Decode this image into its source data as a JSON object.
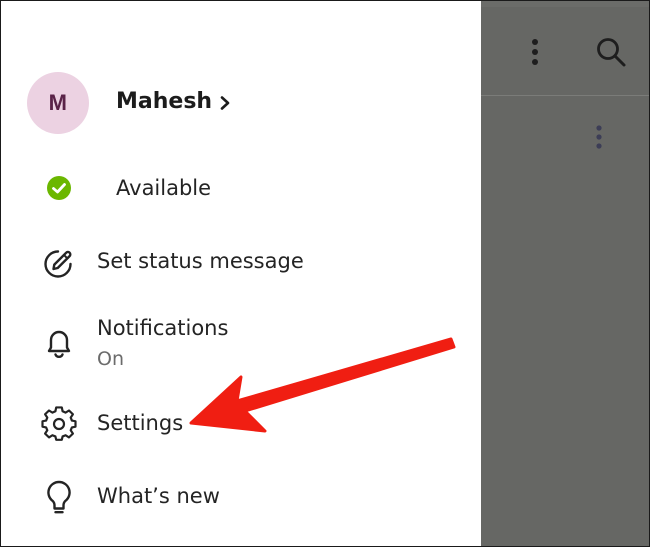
{
  "profile": {
    "initial": "M",
    "name": "Mahesh",
    "avatar_bg": "#ecd2e2",
    "avatar_fg": "#5a2348"
  },
  "status": {
    "label": "Available",
    "color": "#6bb700",
    "icon": "check-circle-icon"
  },
  "menu": {
    "set_status": {
      "label": "Set status message",
      "icon": "pencil-circle-icon"
    },
    "notifications": {
      "label": "Notifications",
      "value": "On",
      "icon": "bell-icon"
    },
    "settings": {
      "label": "Settings",
      "icon": "gear-icon"
    },
    "whats_new": {
      "label": "What’s new",
      "icon": "lightbulb-icon"
    }
  },
  "background_app": {
    "overlay_color": "#666764",
    "icons": [
      "more-vertical-icon",
      "search-icon",
      "more-vertical-icon"
    ]
  },
  "annotation": {
    "type": "arrow",
    "color": "#f01e12",
    "target": "settings"
  }
}
